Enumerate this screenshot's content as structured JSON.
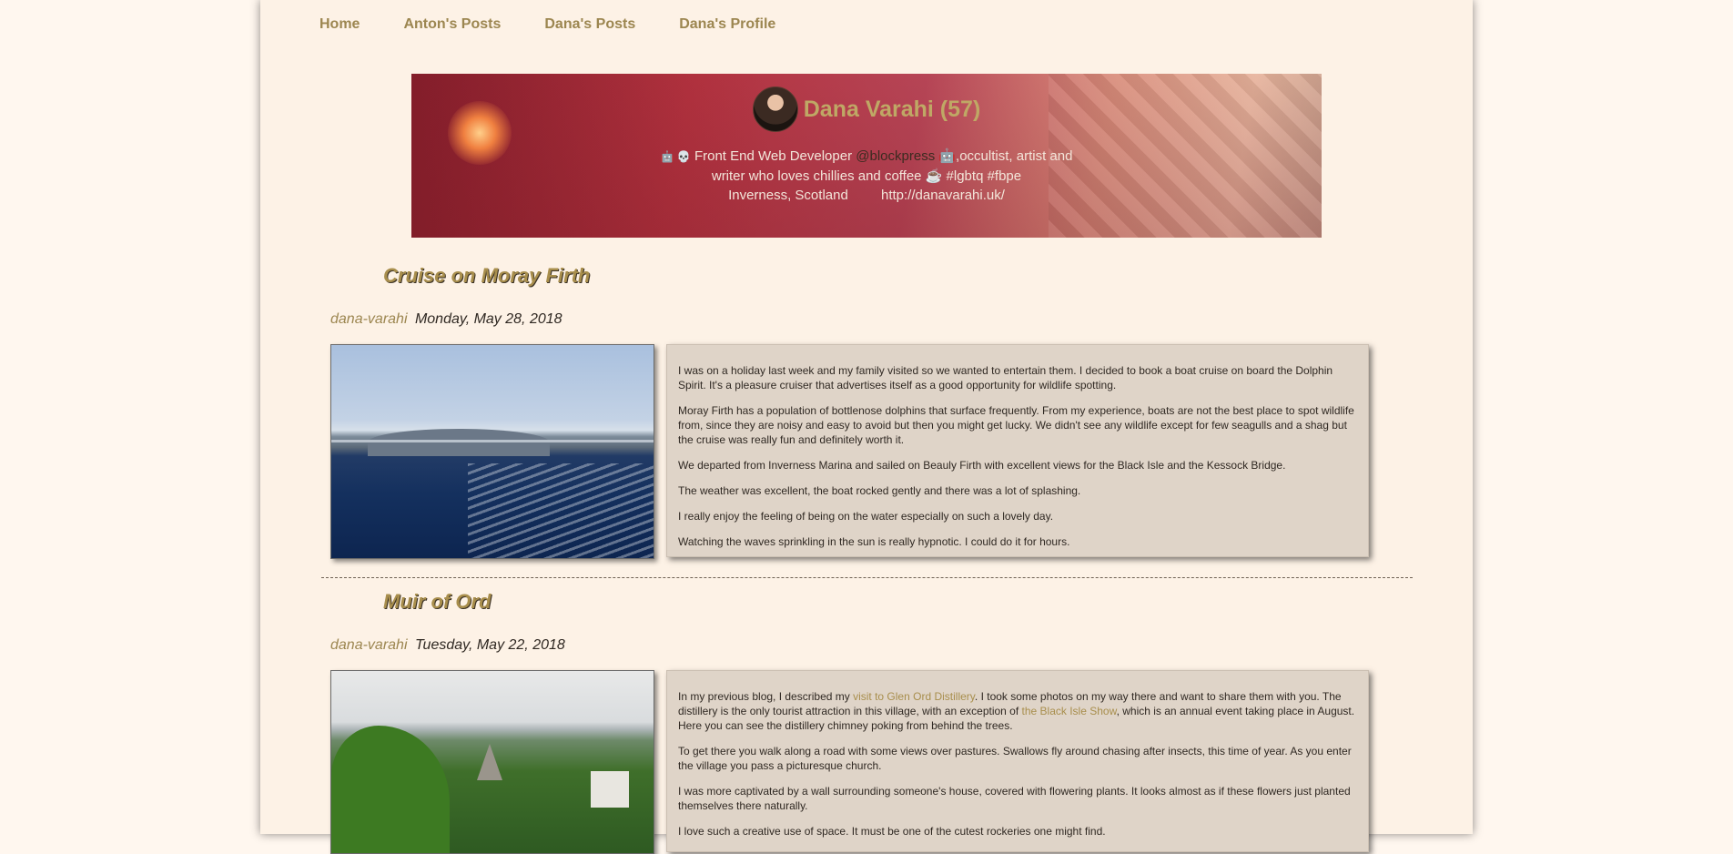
{
  "nav": {
    "items": [
      "Home",
      "Anton's Posts",
      "Dana's Posts",
      "Dana's Profile"
    ]
  },
  "profile": {
    "name": "Dana Varahi (57)",
    "bio_icons": "🤖 💀",
    "bio_prefix": "Front End Web Developer",
    "handle": "@blockpress",
    "bio_mid": "🤖,occultist, artist and writer who loves chillies and coffee ☕ #lgbtq #fbpe",
    "location": "Inverness, Scotland",
    "website": "http://danavarahi.uk/"
  },
  "posts": [
    {
      "title": "Cruise on Moray Firth",
      "author": "dana-varahi",
      "date": "Monday, May 28, 2018",
      "paragraphs": [
        "I was on a holiday last week and my family visited so we wanted to entertain them. I decided to book a boat cruise on board the Dolphin Spirit. It's a pleasure cruiser that advertises itself as a good opportunity for wildlife spotting.",
        "Moray Firth has a population of bottlenose dolphins that surface frequently. From my experience, boats are not the best place to spot wildlife from, since they are noisy and easy to avoid but then you might get lucky. We didn't see any wildlife except for few seagulls and a shag but the cruise was really fun and definitely worth it.",
        "We departed from Inverness Marina and sailed on Beauly Firth with excellent views for the Black Isle and the Kessock Bridge.",
        "The weather was excellent, the boat rocked gently and there was a lot of splashing.",
        "I really enjoy the feeling of being on the water especially on such a lovely day.",
        "Watching the waves sprinkling in the sun is really hypnotic. I could do it for hours."
      ]
    },
    {
      "title": "Muir of Ord",
      "author": "dana-varahi",
      "date": "Tuesday, May 22, 2018",
      "p1_before": "In my previous blog, I described my ",
      "p1_link1": "visit to Glen Ord Distillery",
      "p1_mid": ". I took some photos on my way there and want to share them with you. The distillery is the only tourist attraction in this village, with an exception of ",
      "p1_link2": "the Black Isle Show",
      "p1_after": ", which is an annual event taking place in August. Here you can see the distillery chimney poking from behind the trees.",
      "p2": "To get there you walk along a road with some views over pastures. Swallows fly around chasing after insects, this time of year. As you enter the village you pass a picturesque church.",
      "p3": "I was more captivated by a wall surrounding someone's house, covered with flowering plants. It looks almost as if these flowers just planted themselves there naturally.",
      "p4": "I love such a creative use of space. It must be one of the cutest rockeries one might find."
    }
  ]
}
